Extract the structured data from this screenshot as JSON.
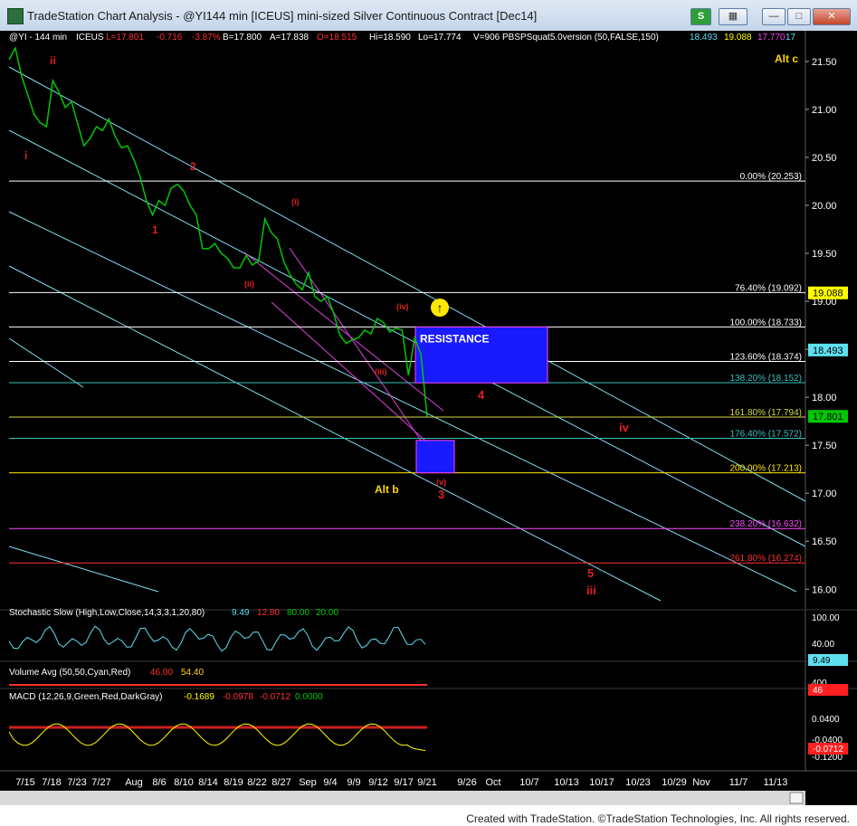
{
  "window": {
    "title": "TradeStation Chart Analysis - @YI144 min [ICEUS] mini-sized Silver Continuous Contract [Dec14]",
    "buttons": {
      "s_label": "S",
      "grid_label": "▦",
      "min_label": "—",
      "max_label": "□",
      "close_label": "✕"
    }
  },
  "footer": {
    "text": "Created with TradeStation. ©TradeStation Technologies, Inc. All rights reserved."
  },
  "colors": {
    "background": "#000000",
    "price": "#00c800",
    "channel": "#7fdcec",
    "fib_white": "#ffffff",
    "resistance_box": "#1a1aff",
    "wave_label": "#e02020",
    "yellow": "#ffd800"
  },
  "chart_data": [
    {
      "type": "line",
      "header": {
        "symbol": "@YI - 144 min",
        "exchange": "ICEUS",
        "last": "L=17.801",
        "change": "-0.716",
        "change_pct": "-3.87%",
        "bid": "B=17.800",
        "ask": "A=17.838",
        "open": "O=18.515",
        "high": "Hi=18.590",
        "low": "Lo=17.774",
        "volume": "V=906",
        "study": "PBSPSquat5.0version (50,FALSE,150)",
        "study_v1": "18.493",
        "study_v2": "19.088",
        "study_v3": "17.770",
        "study_v4": "17"
      },
      "y_ticks": [
        "21.50",
        "21.00",
        "20.50",
        "20.00",
        "19.50",
        "19.00",
        "18.50",
        "18.00",
        "17.50",
        "17.00",
        "16.50",
        "16.00"
      ],
      "ylim": [
        15.88,
        21.65
      ],
      "x_ticks": [
        "7/15",
        "7/18",
        "7/23",
        "7/27",
        "Aug",
        "8/6",
        "8/10",
        "8/14",
        "8/19",
        "8/22",
        "8/27",
        "Sep",
        "9/4",
        "9/9",
        "9/12",
        "9/17",
        "9/21",
        "9/26",
        "Oct",
        "10/7",
        "10/13",
        "10/17",
        "10/23",
        "10/29",
        "Nov",
        "11/7",
        "11/13"
      ],
      "price_path": [
        [
          0,
          21.52
        ],
        [
          1,
          21.64
        ],
        [
          2,
          21.35
        ],
        [
          3,
          21.15
        ],
        [
          4,
          20.95
        ],
        [
          5,
          20.86
        ],
        [
          6,
          20.82
        ],
        [
          7,
          21.3
        ],
        [
          8,
          21.18
        ],
        [
          9,
          21.02
        ],
        [
          10,
          21.08
        ],
        [
          11,
          20.85
        ],
        [
          12,
          20.62
        ],
        [
          13,
          20.7
        ],
        [
          14,
          20.82
        ],
        [
          15,
          20.78
        ],
        [
          16,
          20.9
        ],
        [
          17,
          20.72
        ],
        [
          18,
          20.6
        ],
        [
          19,
          20.62
        ],
        [
          20,
          20.48
        ],
        [
          21,
          20.3
        ],
        [
          22,
          20.05
        ],
        [
          23,
          19.9
        ],
        [
          24,
          20.05
        ],
        [
          25,
          20.0
        ],
        [
          26,
          20.18
        ],
        [
          27,
          20.22
        ],
        [
          28,
          20.15
        ],
        [
          29,
          20.0
        ],
        [
          30,
          19.9
        ],
        [
          31,
          19.55
        ],
        [
          32,
          19.55
        ],
        [
          33,
          19.6
        ],
        [
          34,
          19.5
        ],
        [
          35,
          19.45
        ],
        [
          36,
          19.35
        ],
        [
          37,
          19.35
        ],
        [
          38,
          19.48
        ],
        [
          39,
          19.38
        ],
        [
          40,
          19.42
        ],
        [
          41,
          19.86
        ],
        [
          42,
          19.72
        ],
        [
          43,
          19.65
        ],
        [
          44,
          19.42
        ],
        [
          45,
          19.28
        ],
        [
          46,
          19.18
        ],
        [
          47,
          19.12
        ],
        [
          48,
          19.3
        ],
        [
          49,
          19.05
        ],
        [
          50,
          19.0
        ],
        [
          51,
          19.05
        ],
        [
          52,
          18.88
        ],
        [
          53,
          18.65
        ],
        [
          54,
          18.56
        ],
        [
          55,
          18.6
        ],
        [
          56,
          18.62
        ],
        [
          57,
          18.7
        ],
        [
          58,
          18.66
        ],
        [
          59,
          18.82
        ],
        [
          60,
          18.78
        ],
        [
          61,
          18.68
        ],
        [
          62,
          18.72
        ],
        [
          63,
          18.7
        ],
        [
          64,
          18.23
        ],
        [
          65,
          18.62
        ],
        [
          66,
          18.45
        ],
        [
          67,
          17.8
        ]
      ],
      "last_price": 17.801,
      "fib_levels": [
        {
          "label": "0.00% (20.253)",
          "value": 20.253,
          "color": "#ffffff"
        },
        {
          "label": "76.40% (19.092)",
          "value": 19.092,
          "color": "#ffffff"
        },
        {
          "label": "100.00% (18.733)",
          "value": 18.733,
          "color": "#ffffff"
        },
        {
          "label": "123.60% (18.374)",
          "value": 18.374,
          "color": "#ffffff"
        },
        {
          "label": "138.20% (18.152)",
          "value": 18.152,
          "color": "#3ec0b8"
        },
        {
          "label": "161.80% (17.794)",
          "value": 17.794,
          "color": "#d8d84a"
        },
        {
          "label": "176.40% (17.572)",
          "value": 17.572,
          "color": "#3ec0b8"
        },
        {
          "label": "200.00% (17.213)",
          "value": 17.213,
          "color": "#ffe800"
        },
        {
          "label": "238.20% (16.632)",
          "value": 16.632,
          "color": "#ff4cff"
        },
        {
          "label": "261.80% (16.274)",
          "value": 16.274,
          "color": "#ff3030"
        }
      ],
      "right_badges": [
        {
          "label": "19.088",
          "value": 19.088,
          "bg": "#ffff00",
          "fg": "#000000"
        },
        {
          "label": "18.493",
          "value": 18.493,
          "bg": "#5ee0f0",
          "fg": "#000000"
        },
        {
          "label": "17.801",
          "value": 17.801,
          "bg": "#00c800",
          "fg": "#000000"
        }
      ],
      "annotations": {
        "resistance": "RESISTANCE",
        "alt_c": "Alt c",
        "alt_b": "Alt b",
        "waves": [
          "ii",
          "i",
          "1",
          "2",
          "(ii)",
          "(i)",
          "(iv)",
          "(iii)",
          "(v)",
          "3",
          "4",
          "iv",
          "5",
          "iii"
        ]
      }
    },
    {
      "type": "line",
      "title": "Stochastic Slow (High,Low,Close,14,3,3,1,20,80)",
      "values": [
        "9.49",
        "12.80",
        "80.00",
        "20.00"
      ],
      "y_ticks": [
        "100.00",
        "40.00"
      ],
      "badge": "9.49"
    },
    {
      "type": "bar",
      "title": "Volume Avg (50,50,Cyan,Red)",
      "values": [
        "46.00",
        "54.40"
      ],
      "y_ticks": [
        "400"
      ],
      "badge": "46"
    },
    {
      "type": "bar",
      "title": "MACD (12,26,9,Green,Red,DarkGray)",
      "values": [
        "-0.1689",
        "-0.0978",
        "-0.0712",
        "0.0000"
      ],
      "y_ticks": [
        "0.0400",
        "-0.0400",
        "-0.1200"
      ],
      "badge": "-0.0712"
    }
  ]
}
